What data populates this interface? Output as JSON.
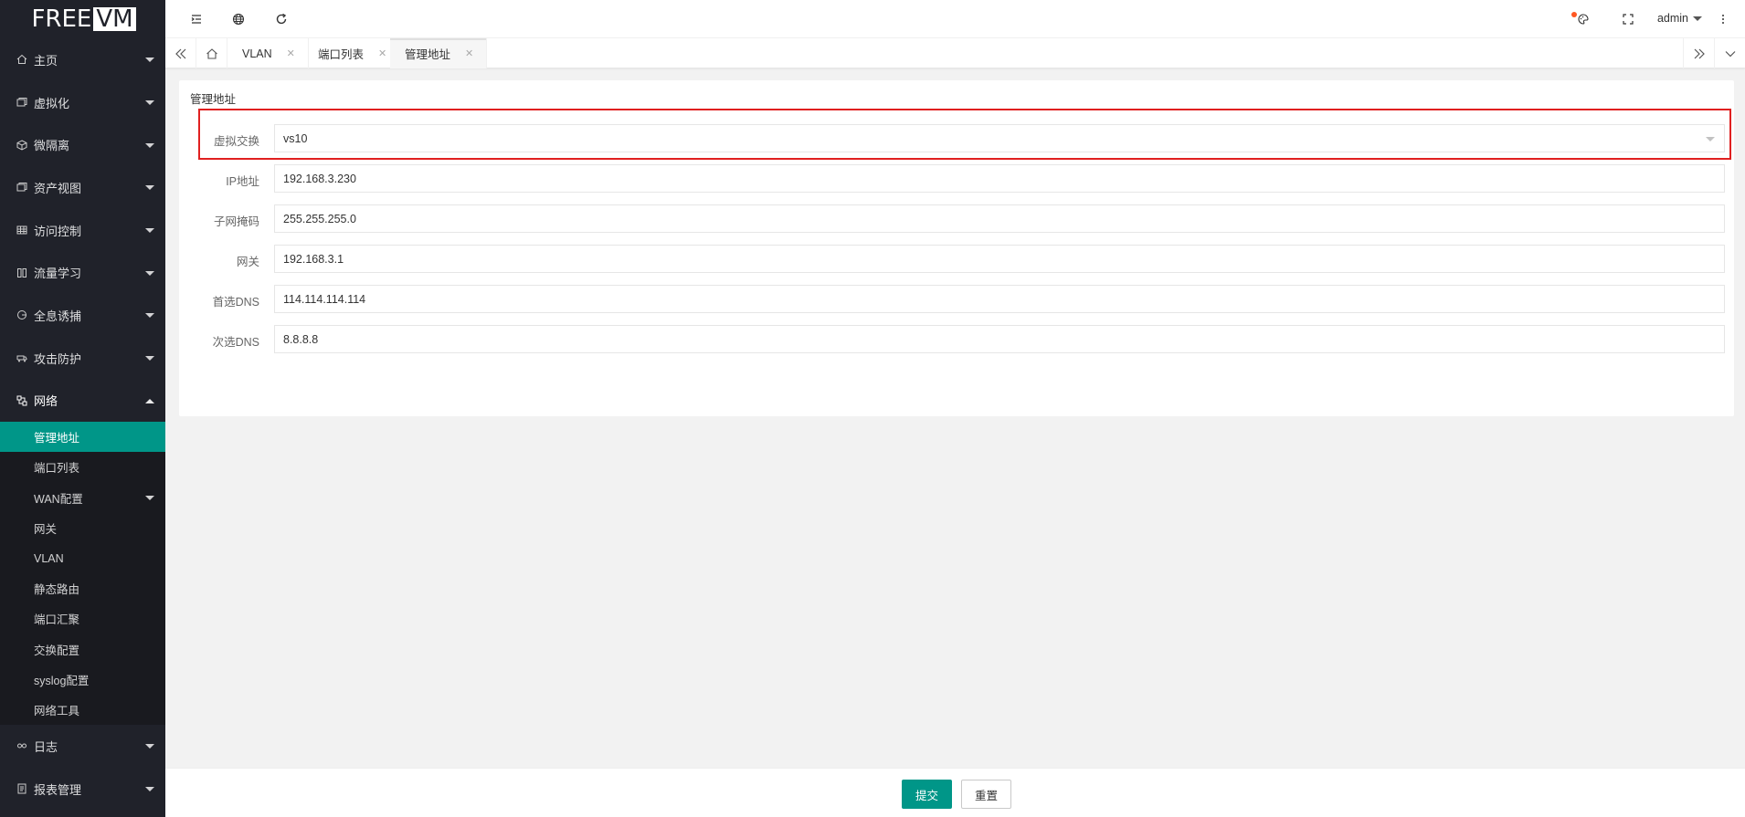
{
  "logo": {
    "part1": "FREE",
    "part2": "VM"
  },
  "sidebar": {
    "items": [
      {
        "label": "主页",
        "icon": "home-icon"
      },
      {
        "label": "虚拟化",
        "icon": "layers-icon"
      },
      {
        "label": "微隔离",
        "icon": "cube-icon"
      },
      {
        "label": "资产视图",
        "icon": "layers-icon"
      },
      {
        "label": "访问控制",
        "icon": "grid-icon"
      },
      {
        "label": "流量学习",
        "icon": "book-icon"
      },
      {
        "label": "全息诱捕",
        "icon": "target-icon"
      },
      {
        "label": "攻击防护",
        "icon": "truck-icon"
      },
      {
        "label": "网络",
        "icon": "network-icon"
      }
    ],
    "network_sub": [
      {
        "label": "管理地址"
      },
      {
        "label": "端口列表"
      },
      {
        "label": "WAN配置"
      },
      {
        "label": "网关"
      },
      {
        "label": "VLAN"
      },
      {
        "label": "静态路由"
      },
      {
        "label": "端口汇聚"
      },
      {
        "label": "交换配置"
      },
      {
        "label": "syslog配置"
      },
      {
        "label": "网络工具"
      }
    ],
    "bottom_items": [
      {
        "label": "日志",
        "icon": "link-icon"
      },
      {
        "label": "报表管理",
        "icon": "file-icon"
      }
    ]
  },
  "header": {
    "user": "admin"
  },
  "tabs": [
    {
      "label": "VLAN"
    },
    {
      "label": "端口列表"
    },
    {
      "label": "管理地址"
    }
  ],
  "form": {
    "title": "管理地址",
    "fields": [
      {
        "label": "虚拟交换",
        "value": "vs10"
      },
      {
        "label": "IP地址",
        "value": "192.168.3.230"
      },
      {
        "label": "子网掩码",
        "value": "255.255.255.0"
      },
      {
        "label": "网关",
        "value": "192.168.3.1"
      },
      {
        "label": "首选DNS",
        "value": "114.114.114.114"
      },
      {
        "label": "次选DNS",
        "value": "8.8.8.8"
      }
    ]
  },
  "footer": {
    "submit": "提交",
    "reset": "重置"
  },
  "colors": {
    "accent": "#009688",
    "sidebar_bg": "#20222a",
    "highlight": "#e02020",
    "badge": "#ff5722"
  }
}
